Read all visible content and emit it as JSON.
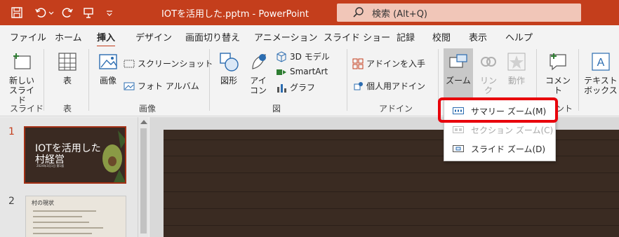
{
  "window": {
    "title": "IOTを活用した.pptm  -  PowerPoint",
    "search_text": "検索 (Alt+Q)"
  },
  "tabs": [
    {
      "label": "ファイル"
    },
    {
      "label": "ホーム"
    },
    {
      "label": "挿入"
    },
    {
      "label": "デザイン"
    },
    {
      "label": "画面切り替え"
    },
    {
      "label": "アニメーション"
    },
    {
      "label": "スライド ショー"
    },
    {
      "label": "記録"
    },
    {
      "label": "校閲"
    },
    {
      "label": "表示"
    },
    {
      "label": "ヘルプ"
    }
  ],
  "active_tab": "挿入",
  "ribbon": {
    "new_slide": "新しい\nスライド",
    "table": "表",
    "images": "画像",
    "screenshot": "スクリーンショット",
    "photo_album": "フォト アルバム",
    "shapes": "図形",
    "icons": "アイ\nコン",
    "model_3d": "3D モデル",
    "smartart": "SmartArt",
    "graph": "グラフ",
    "get_addins": "アドインを入手",
    "my_addins": "個人用アドイン",
    "zoom": "ズーム",
    "link": "リン\nク",
    "action": "動作",
    "comment": "コメント",
    "textbox": "テキスト\nボックス",
    "groups": {
      "slides": "スライド",
      "tables": "表",
      "images": "画像",
      "illustrations": "図",
      "addins": "アドイン",
      "comments_partial": "ント"
    }
  },
  "slides": [
    {
      "number": "1",
      "title": "IOTを活用した村経営",
      "subtitle": "2024年3月1日 第1版"
    },
    {
      "number": "2",
      "title": "村の現状"
    }
  ],
  "zoom_menu": {
    "items": [
      {
        "label": "サマリー ズーム(M)",
        "enabled": true
      },
      {
        "label": "セクション ズーム(C)",
        "enabled": false
      },
      {
        "label": "スライド ズーム(D)",
        "enabled": true
      }
    ]
  },
  "colors": {
    "accent": "#c43e1c",
    "highlight": "#e8000b"
  }
}
